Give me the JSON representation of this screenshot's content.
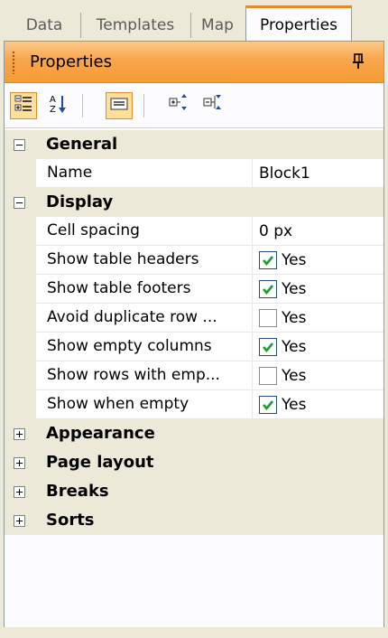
{
  "tabs": [
    {
      "label": "Data"
    },
    {
      "label": "Templates"
    },
    {
      "label": "Map"
    },
    {
      "label": "Properties",
      "active": true
    }
  ],
  "panel": {
    "title": "Properties",
    "pin_icon": "pin-icon"
  },
  "toolbar": {
    "buttons": [
      {
        "name": "categorized-view-button",
        "icon": "categorized-icon",
        "checked": true
      },
      {
        "name": "alphabetical-sort-button",
        "icon": "sort-az-icon",
        "checked": false
      },
      {
        "name": "property-pages-button",
        "icon": "property-pages-icon",
        "checked": true
      },
      {
        "name": "expand-all-button",
        "icon": "expand-all-icon",
        "checked": false
      },
      {
        "name": "collapse-all-button",
        "icon": "collapse-all-icon",
        "checked": false
      }
    ]
  },
  "grid": {
    "general": {
      "label": "General",
      "expanded": true,
      "name_label": "Name",
      "name_value": "Block1"
    },
    "display": {
      "label": "Display",
      "expanded": true,
      "cell_spacing_label": "Cell spacing",
      "cell_spacing_value": "0 px",
      "items": [
        {
          "label": "Show table headers",
          "checked": true,
          "value": "Yes"
        },
        {
          "label": "Show table footers",
          "checked": true,
          "value": "Yes"
        },
        {
          "label": "Avoid duplicate row ...",
          "checked": false,
          "value": "Yes"
        },
        {
          "label": "Show empty columns",
          "checked": true,
          "value": "Yes"
        },
        {
          "label": "Show rows with emp...",
          "checked": false,
          "value": "Yes"
        },
        {
          "label": "Show when empty",
          "checked": true,
          "value": "Yes"
        }
      ]
    },
    "collapsed": [
      {
        "label": "Appearance"
      },
      {
        "label": "Page layout"
      },
      {
        "label": "Breaks"
      },
      {
        "label": "Sorts"
      }
    ]
  },
  "colors": {
    "accent": "#e68b2c",
    "titlebar": "#f8a64c",
    "check": "#1f9a2d"
  }
}
